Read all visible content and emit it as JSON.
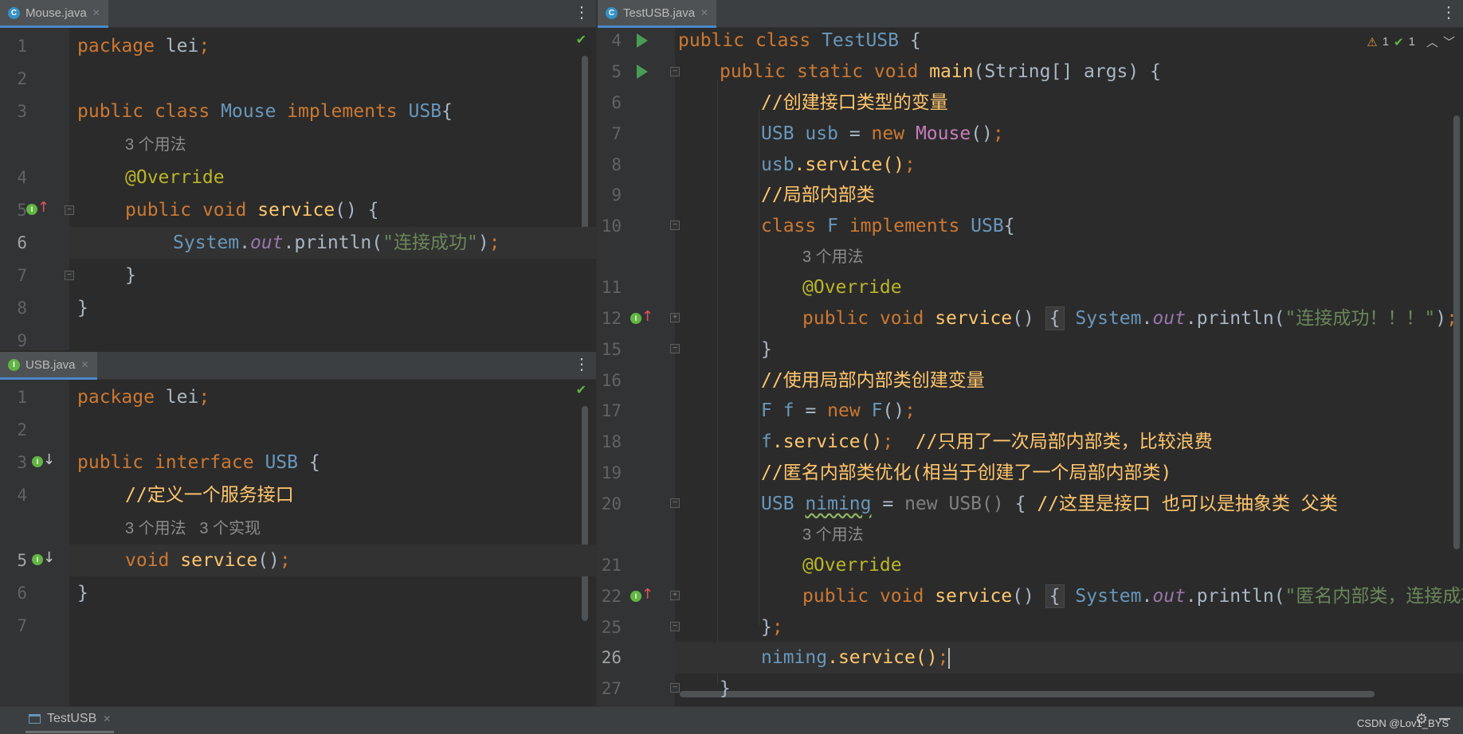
{
  "left_top": {
    "tab": {
      "icon": "C",
      "label": "Mouse.java"
    },
    "lines": [
      "1",
      "2",
      "3",
      "",
      "4",
      "5",
      "6",
      "7",
      "8",
      "9"
    ],
    "hint": "3 个用法",
    "code": {
      "l1a": "package",
      "l1b": "lei",
      "l1c": ";",
      "l3a": "public",
      "l3b": "class",
      "l3c": "Mouse",
      "l3d": "implements",
      "l3e": "USB",
      "l3f": "{",
      "l4": "@Override",
      "l5a": "public",
      "l5b": "void",
      "l5c": "service",
      "l5d": "() {",
      "l6a": "System",
      "l6b": ".",
      "l6c": "out",
      "l6d": ".println(",
      "l6e": "\"连接成功\"",
      "l6f": ")",
      "l6g": ";",
      "l7": "}",
      "l8": "}"
    }
  },
  "left_bottom": {
    "tab": {
      "icon": "I",
      "label": "USB.java"
    },
    "lines": [
      "1",
      "2",
      "3",
      "4",
      "",
      "5",
      "6",
      "7"
    ],
    "hint": "3 个用法   3 个实现",
    "code": {
      "l1a": "package",
      "l1b": "lei",
      "l1c": ";",
      "l3a": "public",
      "l3b": "interface",
      "l3c": "USB",
      "l3d": "{",
      "l4": "//定义一个服务接口",
      "l5a": "void",
      "l5b": "service",
      "l5c": "()",
      "l5d": ";",
      "l6": "}"
    }
  },
  "right": {
    "tab": {
      "icon": "C",
      "label": "TestUSB.java"
    },
    "inspection": {
      "warnings": "1",
      "weak_warnings": "1"
    },
    "lines": [
      "4",
      "5",
      "6",
      "7",
      "8",
      "9",
      "10",
      "",
      "11",
      "12",
      "15",
      "16",
      "17",
      "18",
      "19",
      "20",
      "",
      "21",
      "22",
      "25",
      "26",
      "27"
    ],
    "hint": "3 个用法",
    "code": {
      "l4a": "public",
      "l4b": "class",
      "l4c": "TestUSB",
      "l4d": "{",
      "l5a": "public",
      "l5b": "static",
      "l5c": "void",
      "l5d": "main",
      "l5e": "(String[] args) {",
      "l6": "//创建接口类型的变量",
      "l7a": "USB",
      "l7b": "usb",
      "l7c": "=",
      "l7d": "new",
      "l7e": "Mouse",
      "l7f": "()",
      "l7g": ";",
      "l8a": "usb",
      "l8b": ".service()",
      "l8c": ";",
      "l9": "//局部内部类",
      "l10a": "class",
      "l10b": "F",
      "l10c": "implements",
      "l10d": "USB",
      "l10e": "{",
      "l11": "@Override",
      "l12a": "public",
      "l12b": "void",
      "l12c": "service",
      "l12d": "()",
      "l12e": "{",
      "l12f": "System",
      "l12g": ".",
      "l12h": "out",
      "l12i": ".println(",
      "l12j": "\"连接成功！！！\"",
      "l12k": ")",
      "l12l": ";",
      "l12m": "}",
      "l15": "}",
      "l16": "//使用局部内部类创建变量",
      "l17a": "F",
      "l17b": "f",
      "l17c": "=",
      "l17d": "new",
      "l17e": "F",
      "l17f": "()",
      "l17g": ";",
      "l18a": "f",
      "l18b": ".service()",
      "l18c": ";",
      "l18d": "//只用了一次局部内部类，比较浪费",
      "l19": "//匿名内部类优化(相当于创建了一个局部内部类)",
      "l20a": "USB",
      "l20b": "niming",
      "l20c": "=",
      "l20d": "new",
      "l20e": "USB",
      "l20f": "()",
      "l20g": "{",
      "l20h": "//这里是接口 也可以是抽象类 父类",
      "l21": "@Override",
      "l22a": "public",
      "l22b": "void",
      "l22c": "service",
      "l22d": "()",
      "l22e": "{",
      "l22f": "System",
      "l22g": ".",
      "l22h": "out",
      "l22i": ".println(",
      "l22j": "\"匿名内部类，连接成功\"",
      "l22k": ")",
      "l22l": ";",
      "l25a": "}",
      "l25b": ";",
      "l26a": "niming",
      "l26b": ".service()",
      "l26c": ";",
      "l27": "}"
    }
  },
  "status": {
    "run_tab": "TestUSB",
    "watermark": "CSDN @Lov1_BYS"
  }
}
